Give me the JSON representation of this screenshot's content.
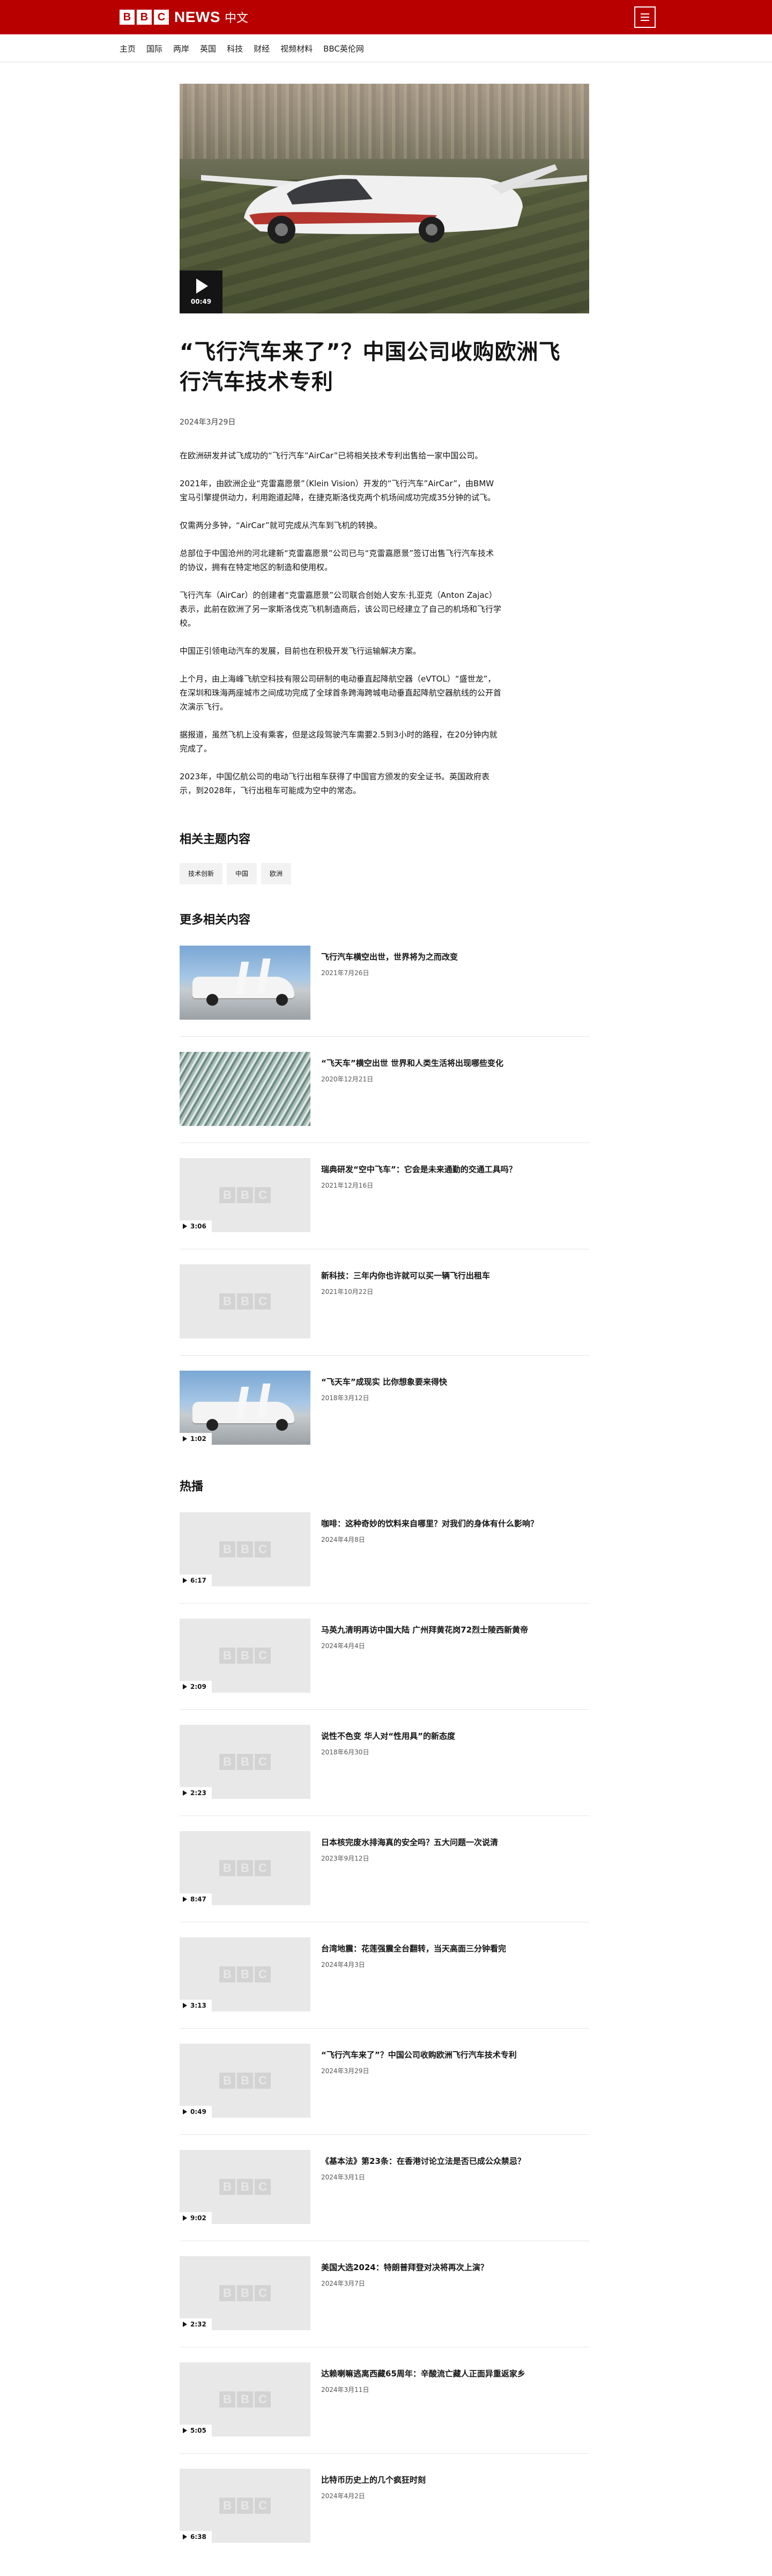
{
  "header": {
    "logo_letters": [
      "B",
      "B",
      "C"
    ],
    "brand": "NEWS",
    "brand_suffix": "中文",
    "menu_icon": "menu-icon",
    "colors": {
      "brand_red": "#b80000"
    }
  },
  "nav": {
    "items": [
      "主页",
      "国际",
      "两岸",
      "英国",
      "科技",
      "财经",
      "视频材料",
      "BBC英伦网"
    ]
  },
  "hero": {
    "play_icon": "play-icon",
    "duration": "00:49"
  },
  "article": {
    "headline": "“飞行汽车来了”？中国公司收购欧洲飞行汽车技术专利",
    "date": "2024年3月29日",
    "paragraphs": [
      "在欧洲研发并试飞成功的“飞行汽车”AirCar”已将相关技术专利出售给一家中国公司。",
      "2021年，由欧洲企业“克雷嘉愿景”（Klein Vision）开发的“飞行汽车”AirCar”，由BMW宝马引擎提供动力，利用跑道起降，在捷克斯洛伐克两个机场间成功完成35分钟的试飞。",
      "仅需两分多钟，“AirCar”就可完成从汽车到飞机的转换。",
      "总部位于中国沧州的河北建新“克雷嘉愿景”公司已与“克雷嘉愿景”签订出售飞行汽车技术的协议，拥有在特定地区的制造和使用权。",
      "飞行汽车（AirCar）的创建者“克雷嘉愿景”公司联合创始人安东·扎亚克（Anton Zajac）表示，此前在欧洲了另一家斯洛伐克飞机制造商后，该公司已经建立了自己的机场和飞行学校。",
      "中国正引领电动汽车的发展，目前也在积极开发飞行运输解决方案。",
      "上个月，由上海峰飞航空科技有限公司研制的电动垂直起降航空器（eVTOL）“盛世龙”，在深圳和珠海两座城市之间成功完成了全球首条跨海跨城电动垂直起降航空器航线的公开首次演示飞行。",
      "据报道，虽然飞机上没有乘客，但是这段驾驶汽车需要2.5到3小时的路程，在20分钟内就完成了。",
      "2023年，中国亿航公司的电动飞行出租车获得了中国官方颁发的安全证书。英国政府表示，到2028年，飞行出租车可能成为空中的常态。"
    ]
  },
  "related_topics": {
    "title": "相关主题内容",
    "tags": [
      "技术创新",
      "中国",
      "欧洲"
    ]
  },
  "more_related": {
    "title": "更多相关内容",
    "items": [
      {
        "title": "飞行汽车横空出世，世界将为之而改变",
        "date": "2021年7月26日",
        "thumb": "car",
        "duration": ""
      },
      {
        "title": "“飞天车”横空出世 世界和人类生活将出现哪些变化",
        "date": "2020年12月21日",
        "thumb": "pattern",
        "duration": ""
      },
      {
        "title": "瑞典研发“空中飞车”：它会是未来通勤的交通工具吗？",
        "date": "2021年12月16日",
        "thumb": "placeholder",
        "duration": "3:06"
      },
      {
        "title": "新科技：三年内你也许就可以买一辆飞行出租车",
        "date": "2021年10月22日",
        "thumb": "placeholder",
        "duration": ""
      },
      {
        "title": "“飞天车”成现实 比你想象要来得快",
        "date": "2018年3月12日",
        "thumb": "car",
        "duration": "1:02"
      }
    ]
  },
  "popular": {
    "title": "热播",
    "items": [
      {
        "title": "咖啡：这种奇妙的饮料来自哪里？对我们的身体有什么影响？",
        "date": "2024年4月8日",
        "duration": "6:17"
      },
      {
        "title": "马英九清明再访中国大陆 广州拜黄花岗72烈士陵西新黄帝",
        "date": "2024年4月4日",
        "duration": "2:09"
      },
      {
        "title": "说性不色变 华人对“性用具”的新态度",
        "date": "2018年6月30日",
        "duration": "2:23"
      },
      {
        "title": "日本核完废水排海真的安全吗？五大问题一次说清",
        "date": "2023年9月12日",
        "duration": "8:47"
      },
      {
        "title": "台湾地震：花莲强震全台翻转，当天高面三分钟看完",
        "date": "2024年4月3日",
        "duration": "3:13"
      },
      {
        "title": "“飞行汽车来了”？中国公司收购欧洲飞行汽车技术专利",
        "date": "2024年3月29日",
        "duration": "0:49"
      },
      {
        "title": "《基本法》第23条：在香港讨论立法是否已成公众禁忌？",
        "date": "2024年3月1日",
        "duration": "9:02"
      },
      {
        "title": "美国大选2024：特朗普拜登对决将再次上演？",
        "date": "2024年3月7日",
        "duration": "2:32"
      },
      {
        "title": "达赖喇嘛逃离西藏65周年：辛酸流亡藏人正面异重返家乡",
        "date": "2024年3月11日",
        "duration": "5:05"
      },
      {
        "title": "比特币历史上的几个疯狂时刻",
        "date": "2024年4月2日",
        "duration": "6:38"
      }
    ]
  }
}
